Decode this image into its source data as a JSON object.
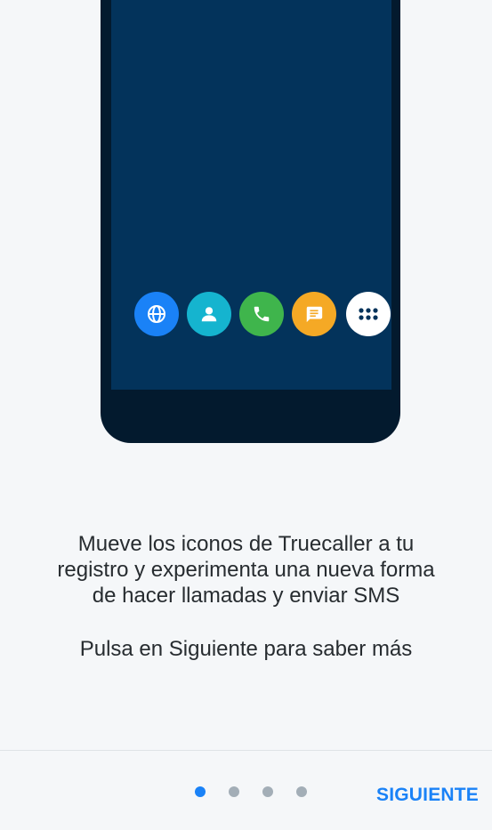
{
  "illustration": {
    "dock_icons": [
      {
        "name": "globe-icon",
        "color": "#1a82f7"
      },
      {
        "name": "contacts-icon",
        "color": "#15b4cf"
      },
      {
        "name": "phone-icon",
        "color": "#3fb54c"
      },
      {
        "name": "message-icon",
        "color": "#f5a925"
      },
      {
        "name": "apps-grid-icon",
        "color": "#ffffff"
      }
    ]
  },
  "content": {
    "message": "Mueve los iconos de Truecaller a tu\nregistro y experimenta una nueva forma\nde hacer llamadas y enviar SMS",
    "hint": "Pulsa en Siguiente para saber más"
  },
  "footer": {
    "pager": {
      "total": 4,
      "current": 1
    },
    "next_label": "SIGUIENTE"
  },
  "colors": {
    "accent": "#1a82f7",
    "background": "#f5f7f9"
  }
}
